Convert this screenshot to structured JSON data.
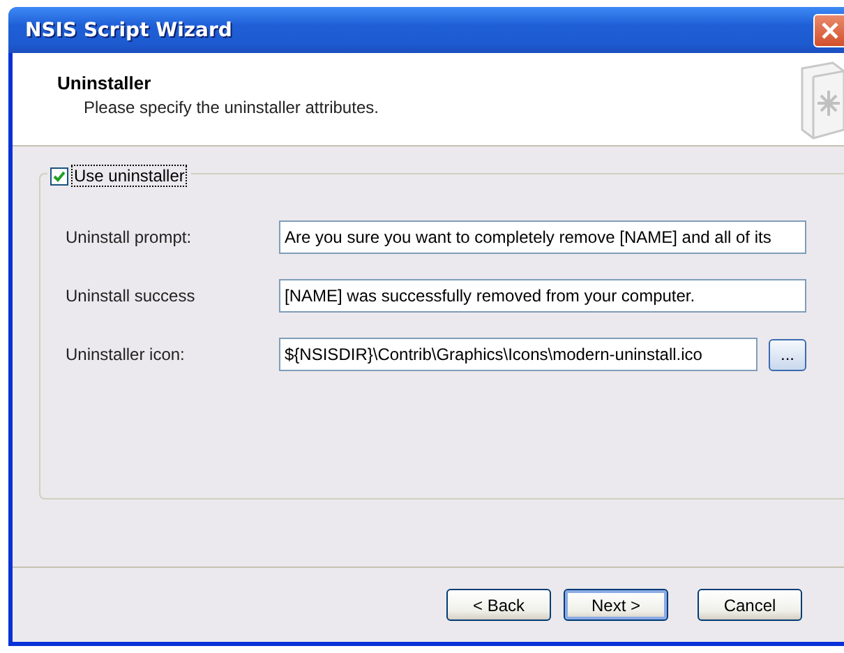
{
  "window": {
    "title": "NSIS Script Wizard"
  },
  "header": {
    "title": "Uninstaller",
    "subtitle": "Please specify the uninstaller attributes."
  },
  "use_uninstaller": {
    "label": "Use uninstaller",
    "checked": true
  },
  "fields": [
    {
      "kind": "text",
      "label": "Uninstall prompt:",
      "value": "Are you sure you want to completely remove [NAME] and all of its"
    },
    {
      "kind": "text",
      "label": "Uninstall success",
      "value": "[NAME] was successfully removed from your computer."
    },
    {
      "kind": "file",
      "label": "Uninstaller icon:",
      "value": "${NSISDIR}\\Contrib\\Graphics\\Icons\\modern-uninstall.ico",
      "browse": "..."
    }
  ],
  "buttons": [
    {
      "label": "< Back",
      "default": false
    },
    {
      "label": "Next >",
      "default": true
    },
    {
      "label": "Cancel",
      "default": false
    }
  ]
}
